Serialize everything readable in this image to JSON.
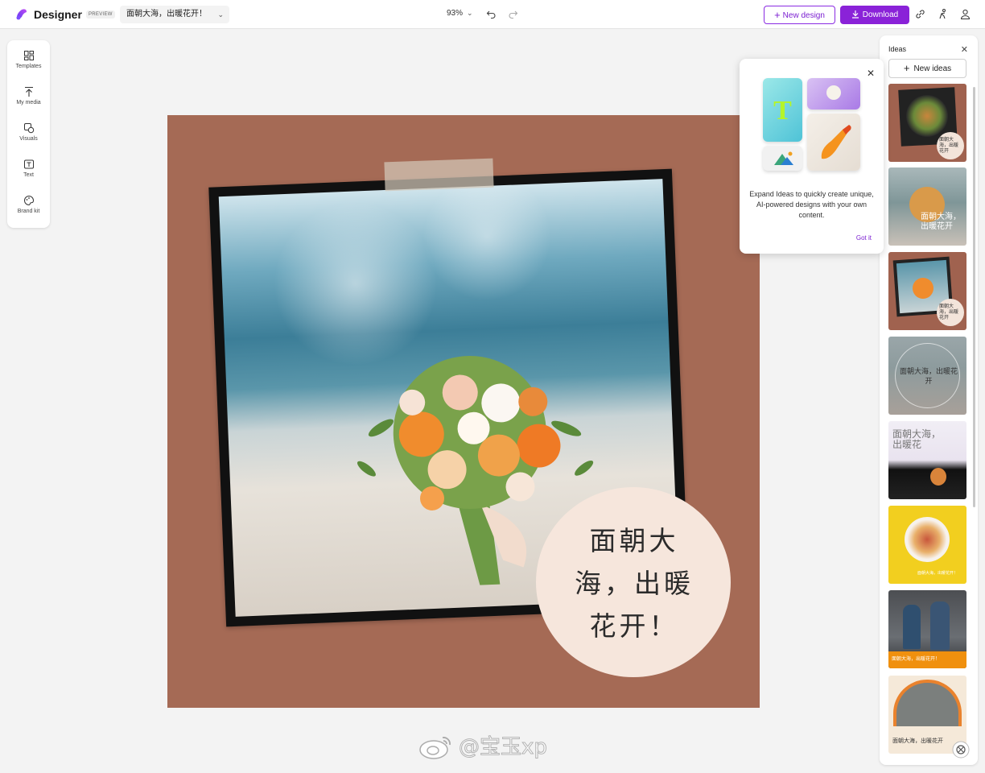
{
  "header": {
    "app_name": "Designer",
    "preview_badge": "PREVIEW",
    "design_name": "面朝大海，出暖花开！",
    "zoom": "93%",
    "new_design_label": "New design",
    "download_label": "Download",
    "accent_color": "#8a22d8"
  },
  "sidebar": {
    "items": [
      {
        "label": "Templates",
        "icon": "templates-icon"
      },
      {
        "label": "My media",
        "icon": "upload-icon"
      },
      {
        "label": "Visuals",
        "icon": "visuals-icon"
      },
      {
        "label": "Text",
        "icon": "text-icon"
      },
      {
        "label": "Brand kit",
        "icon": "brand-kit-icon"
      }
    ]
  },
  "canvas": {
    "background_color": "#a56a55",
    "headline": "面朝大海，出暖花开！",
    "headline_lines": [
      "面朝大",
      "海，出暖",
      "花开！"
    ]
  },
  "popup": {
    "message": "Expand Ideas to quickly create unique, AI-powered designs with your own content.",
    "action": "Got it"
  },
  "ideas": {
    "title": "Ideas",
    "new_ideas_label": "New ideas",
    "thumbs": [
      {
        "caption": "面朝大海，出暖花开"
      },
      {
        "caption": "面朝大海，出暖花开"
      },
      {
        "caption": "面朝大海，出暖花开"
      },
      {
        "caption": "面朝大海，出暖花开"
      },
      {
        "caption": "面朝大海，出暖花"
      },
      {
        "caption": "面朝大海，出暖花开！"
      },
      {
        "caption": "面朝大海，出暖花开！"
      },
      {
        "caption": "面朝大海，出暖花开"
      }
    ]
  },
  "watermark": "@宝玉xp"
}
